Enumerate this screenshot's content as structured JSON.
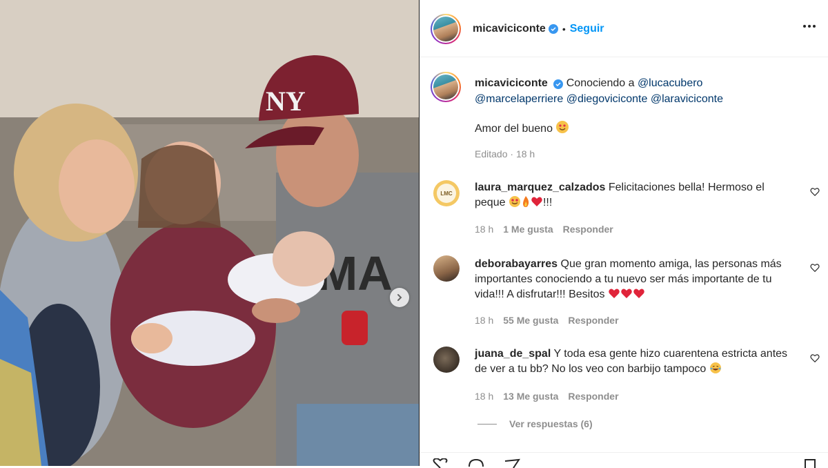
{
  "post": {
    "author": "micaviciconte",
    "follow_label": "Seguir",
    "separator": "•",
    "caption_intro": "Conociendo a",
    "mentions": [
      "@lucacubero",
      "@marcelaperriere",
      "@diegoviciconte",
      "@laraviciconte"
    ],
    "caption_line2": "Amor del bueno",
    "edited_label": "Editado",
    "edited_time": "18 h",
    "meta_sep": "·"
  },
  "comments": [
    {
      "user": "laura_marquez_calzados",
      "text": "Felicitaciones bella! Hermoso el",
      "text2": "peque",
      "text2_suffix": "!!!",
      "time": "18 h",
      "likes": "1 Me gusta",
      "reply": "Responder",
      "avatar_text": "LMC"
    },
    {
      "user": "deborabayarres",
      "text": "Que gran momento amiga, las personas más importantes conociendo a tu nuevo ser más importante de tu vida!!! A disfrutar!!! Besitos",
      "time": "18 h",
      "likes": "55 Me gusta",
      "reply": "Responder"
    },
    {
      "user": "juana_de_spal",
      "text": "Y toda esa gente hizo cuarentena estricta antes de ver a tu bb? No los veo con barbijo tampoco",
      "time": "18 h",
      "likes": "13 Me gusta",
      "reply": "Responder"
    }
  ],
  "view_replies": "Ver respuestas (6)",
  "photo": {
    "cap_logo_text": "NY",
    "shirt_text": "MA"
  },
  "colors": {
    "link": "#0095f6",
    "mention": "#00376b",
    "muted": "#8e8e8e",
    "verified": "#3897f0"
  },
  "icons": [
    "verified-badge-icon",
    "more-options-icon",
    "chevron-right-icon",
    "heart-icon",
    "like-icon",
    "comment-icon",
    "share-icon",
    "save-icon"
  ]
}
